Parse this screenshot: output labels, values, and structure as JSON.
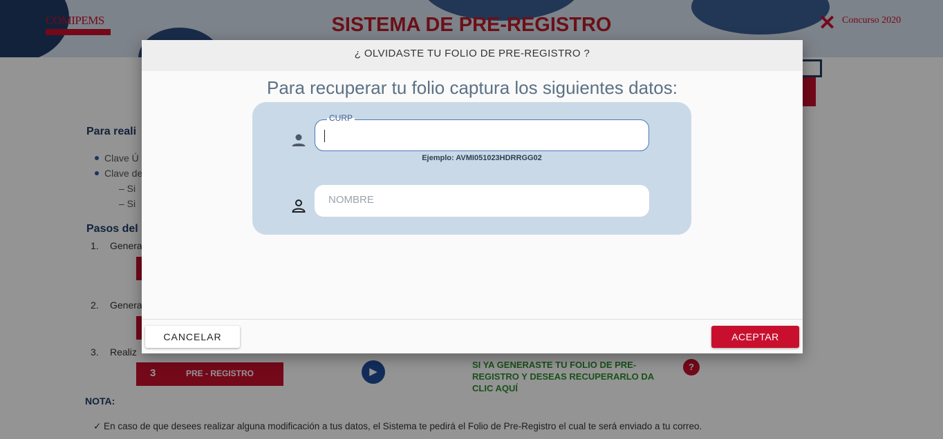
{
  "header": {
    "logo_left": "COMIPEMS",
    "title": "SISTEMA DE PRE-REGISTRO",
    "logo_right": "Concurso 2020"
  },
  "background": {
    "section1_heading": "Para reali",
    "bullets": [
      "Clave Ú",
      "Clave de"
    ],
    "sub_bullets": [
      "– Si",
      "– Si"
    ],
    "section2_heading": "Pasos del p",
    "steps": [
      {
        "number": "1.",
        "label": "Genera"
      },
      {
        "number": "2.",
        "label": "Genera"
      },
      {
        "number": "3.",
        "label": "Realiz"
      }
    ],
    "preregistro_button": {
      "number": "3",
      "label": "PRE - REGISTRO"
    },
    "recover_link": "SI YA GENERASTE TU FOLIO DE PRE-REGISTRO Y DESEAS RECUPERARLO DA CLIC AQUÍ",
    "help_icon": "?",
    "nota_title": "NOTA:",
    "nota_line": "✓  En caso de que desees realizar alguna modificación a tus datos, el Sistema te pedirá el Folio de Pre-Registro el cual te será enviado a tu correo."
  },
  "modal": {
    "title": "¿ OLVIDASTE TU FOLIO DE PRE-REGISTRO ?",
    "subtitle": "Para recuperar tu folio captura los siguientes datos:",
    "fields": {
      "curp": {
        "label": "CURP",
        "value": "",
        "hint": "Ejemplo: AVMI051023HDRRGG02",
        "icon": "person-icon"
      },
      "nombre": {
        "placeholder": "NOMBRE",
        "value": "",
        "icon": "person-outline-icon"
      }
    },
    "cancel_label": "CANCELAR",
    "accept_label": "ACEPTAR"
  },
  "colors": {
    "brand_red": "#c8102e",
    "navy": "#1f3b66",
    "panel": "#c9d9e7",
    "green": "#2c8a2c"
  }
}
